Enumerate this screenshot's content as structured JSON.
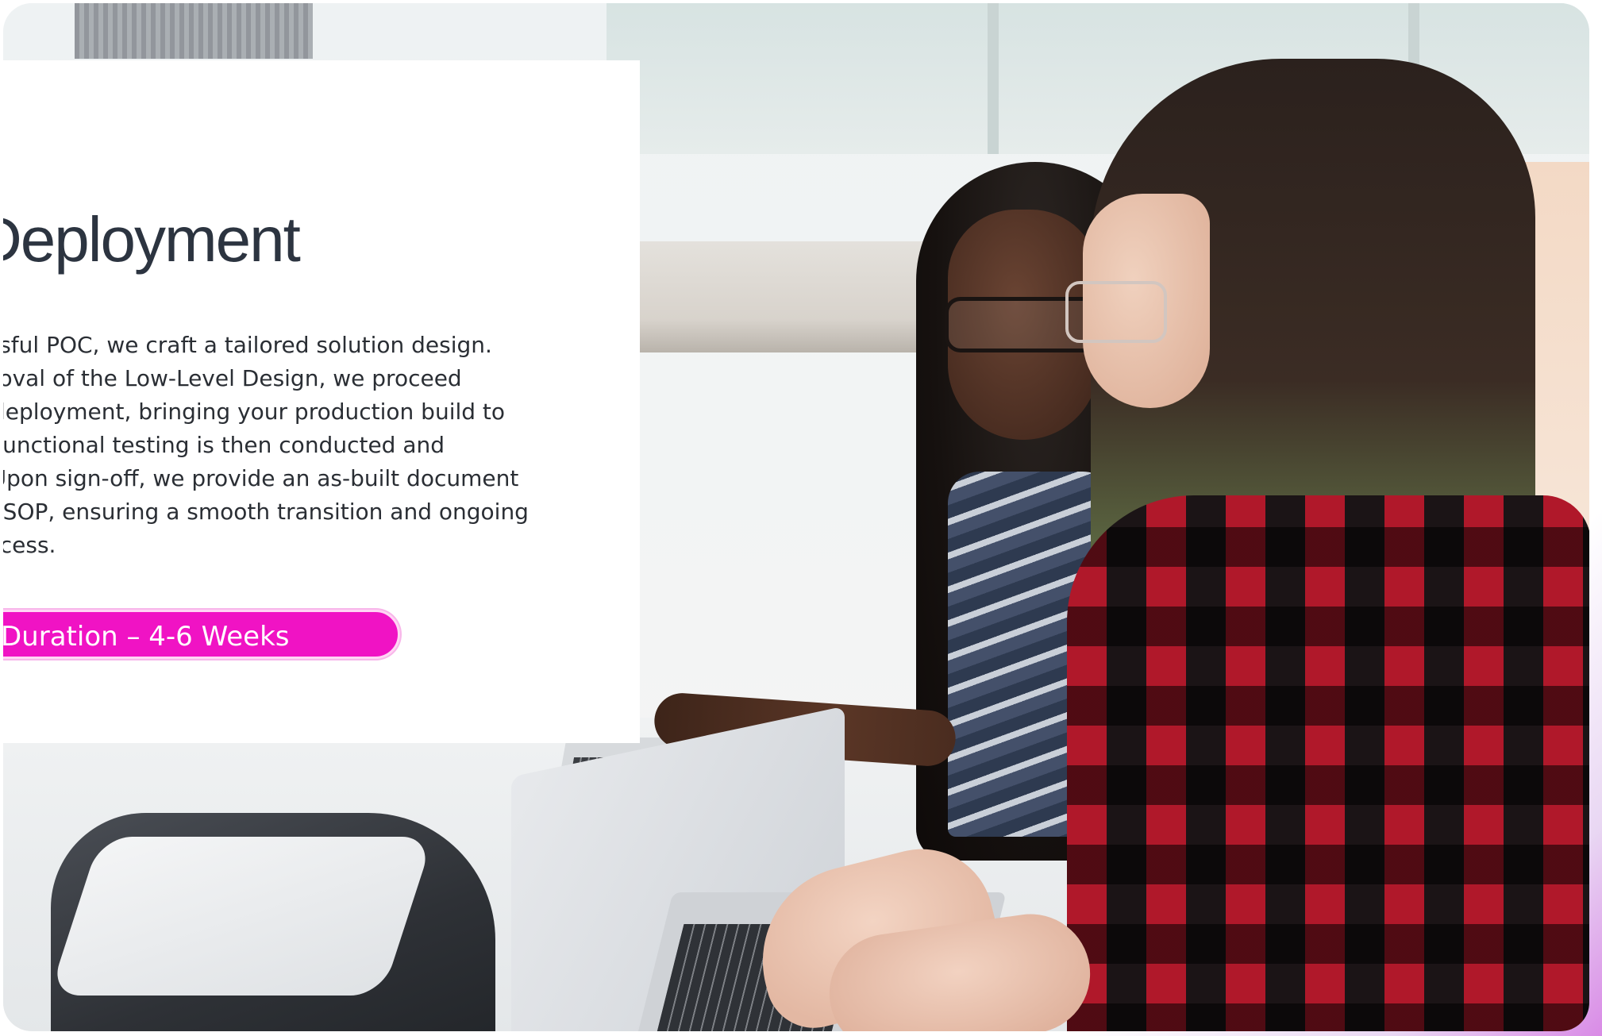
{
  "slide": {
    "title": "Deployment",
    "body_lines": [
      "cessful POC, we craft a tailored solution design.",
      "pproval of the Low-Level Design, we proceed",
      "to deployment, bringing your production build to",
      "us functional testing is then conducted and",
      "d. Upon sign-off, we provide an as-built document",
      "led SOP, ensuring a smooth transition and ongoing",
      " success."
    ],
    "duration_label": "Duration – 4-6 Weeks",
    "accent_color": "#f013c4"
  },
  "photo": {
    "description_icon": "photo-two-women-at-laptops"
  }
}
